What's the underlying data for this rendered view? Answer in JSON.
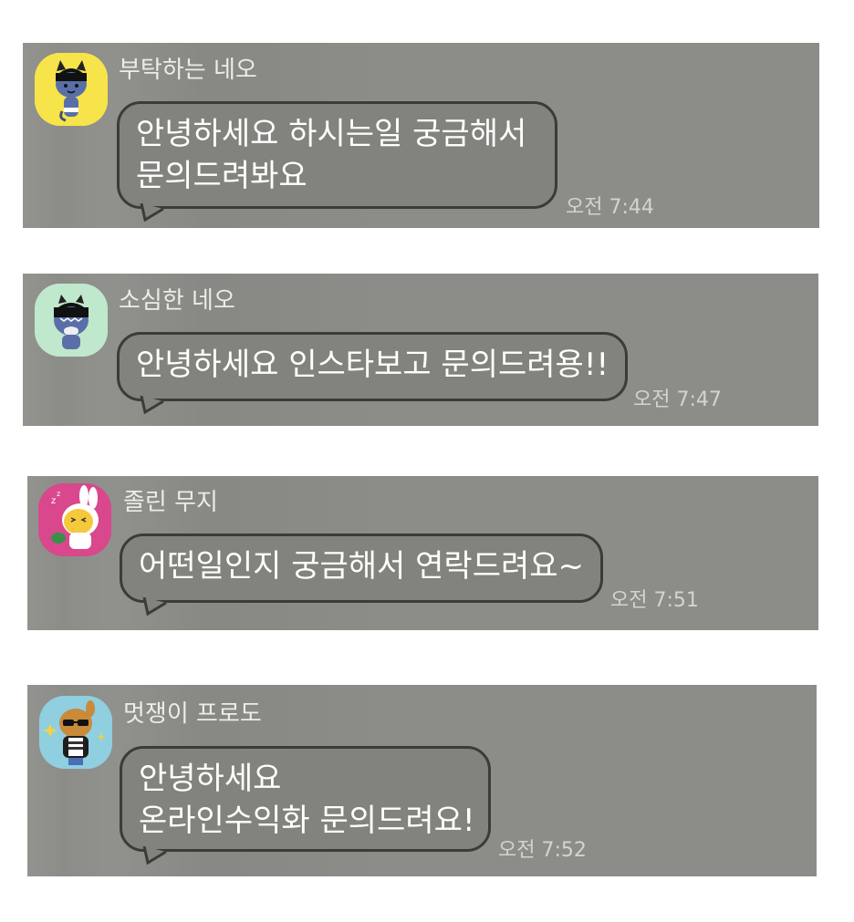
{
  "messages": [
    {
      "sender": "부탁하는 네오",
      "line1": "안녕하세요 하시는일 궁금해서",
      "line2": "문의드려봐요",
      "time": "오전 7:44",
      "avatar_icon": "neo-pleading-avatar",
      "avatar_bg": "#f7e44a"
    },
    {
      "sender": "소심한 네오",
      "line1": "안녕하세요 인스타보고 문의드려용!!",
      "line2": "",
      "time": "오전 7:47",
      "avatar_icon": "neo-shy-avatar",
      "avatar_bg": "#bfe8cc"
    },
    {
      "sender": "졸린 무지",
      "line1": "어떤일인지 궁금해서 연락드려요~",
      "line2": "",
      "time": "오전 7:51",
      "avatar_icon": "muzi-sleepy-avatar",
      "avatar_bg": "#d9488d"
    },
    {
      "sender": "멋쟁이 프로도",
      "line1": "안녕하세요",
      "line2": "온라인수익화 문의드려요!",
      "time": "오전 7:52",
      "avatar_icon": "frodo-stylish-avatar",
      "avatar_bg": "#8fcfe0"
    }
  ]
}
